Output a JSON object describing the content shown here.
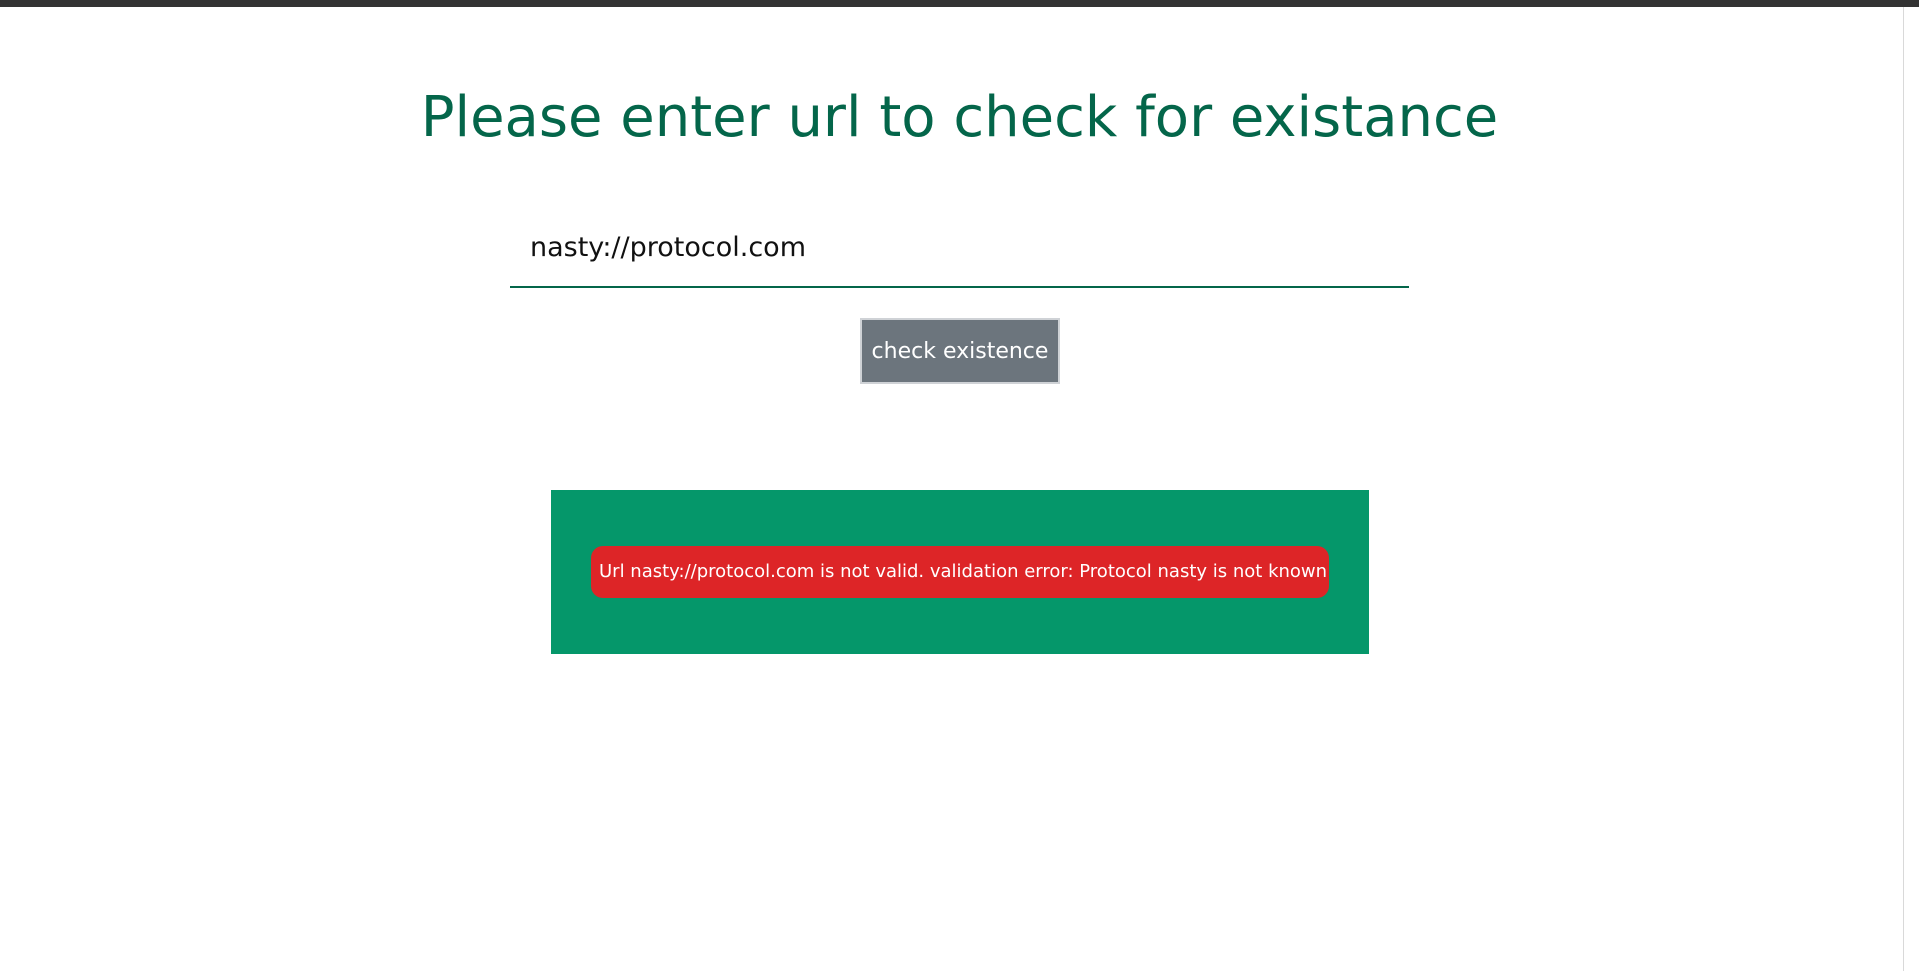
{
  "page": {
    "heading": "Please enter url to check for existance"
  },
  "form": {
    "url_value": "nasty://protocol.com",
    "check_button_label": "check existence"
  },
  "result": {
    "error_message": "Url nasty://protocol.com is not valid. validation error: Protocol nasty is not known"
  },
  "colors": {
    "heading": "#04664a",
    "input_underline": "#04664a",
    "button_bg": "#6c757d",
    "result_panel_bg": "#05976a",
    "error_bg": "#dd2527",
    "topbar": "#333333"
  }
}
